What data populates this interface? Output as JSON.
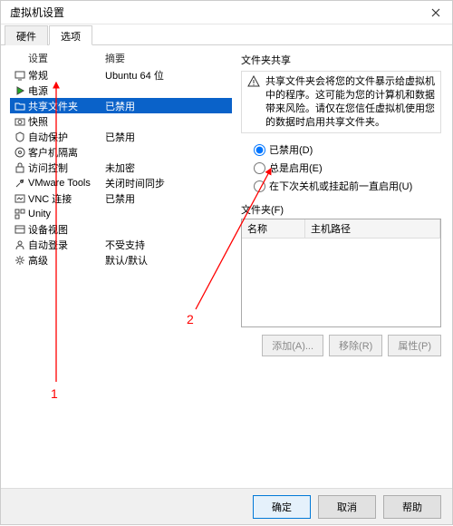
{
  "window": {
    "title": "虚拟机设置"
  },
  "tabs": {
    "hardware": "硬件",
    "options": "选项"
  },
  "headers": {
    "settings": "设置",
    "summary": "摘要"
  },
  "rows": [
    {
      "id": "general",
      "icon": "monitor",
      "label": "常规",
      "summary": "Ubuntu 64 位"
    },
    {
      "id": "power",
      "icon": "play",
      "label": "电源",
      "summary": ""
    },
    {
      "id": "shared",
      "icon": "folder",
      "label": "共享文件夹",
      "summary": "已禁用",
      "selected": true
    },
    {
      "id": "snapshot",
      "icon": "camera",
      "label": "快照",
      "summary": ""
    },
    {
      "id": "autoprotect",
      "icon": "shield",
      "label": "自动保护",
      "summary": "已禁用"
    },
    {
      "id": "guestiso",
      "icon": "disk",
      "label": "客户机隔离",
      "summary": ""
    },
    {
      "id": "access",
      "icon": "lock",
      "label": "访问控制",
      "summary": "未加密"
    },
    {
      "id": "vmtools",
      "icon": "tools",
      "label": "VMware Tools",
      "summary": "关闭时间同步"
    },
    {
      "id": "vnc",
      "icon": "vnc",
      "label": "VNC 连接",
      "summary": "已禁用"
    },
    {
      "id": "unity",
      "icon": "unity",
      "label": "Unity",
      "summary": ""
    },
    {
      "id": "devview",
      "icon": "device",
      "label": "设备视图",
      "summary": ""
    },
    {
      "id": "autologon",
      "icon": "user",
      "label": "自动登录",
      "summary": "不受支持"
    },
    {
      "id": "advanced",
      "icon": "gear",
      "label": "高级",
      "summary": "默认/默认"
    }
  ],
  "sharing": {
    "title": "文件夹共享",
    "warning": "共享文件夹会将您的文件暴示给虚拟机中的程序。这可能为您的计算机和数据带来风险。请仅在您信任虚拟机使用您的数据时启用共享文件夹。",
    "radio_disabled": "已禁用(D)",
    "radio_always": "总是启用(E)",
    "radio_until": "在下次关机或挂起前一直启用(U)"
  },
  "folder": {
    "title": "文件夹(F)",
    "col_name": "名称",
    "col_path": "主机路径",
    "add": "添加(A)...",
    "remove": "移除(R)",
    "props": "属性(P)"
  },
  "buttons": {
    "ok": "确定",
    "cancel": "取消",
    "help": "帮助"
  },
  "annotations": {
    "a1": "1",
    "a2": "2"
  }
}
